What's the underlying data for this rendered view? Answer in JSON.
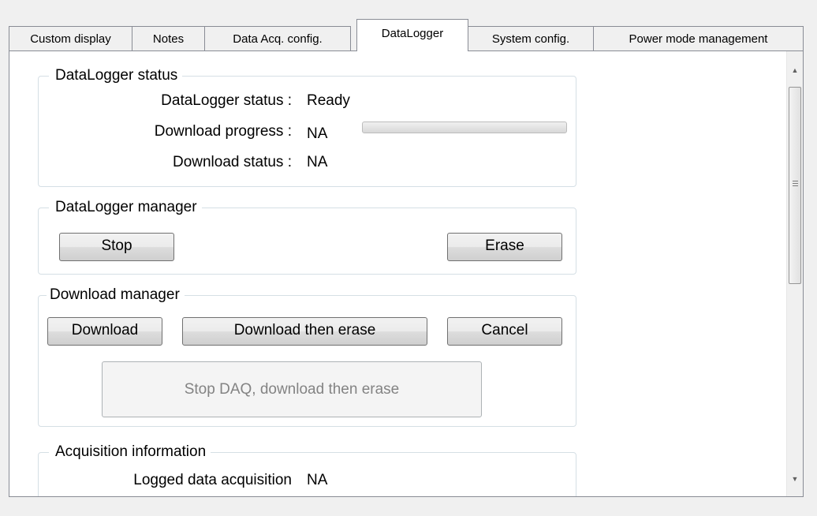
{
  "tabs": [
    {
      "label": "Custom display",
      "active": false
    },
    {
      "label": "Notes",
      "active": false
    },
    {
      "label": "Data Acq. config.",
      "active": false
    },
    {
      "label": "DataLogger",
      "active": true
    },
    {
      "label": "System config.",
      "active": false
    },
    {
      "label": "Power mode management",
      "active": false
    }
  ],
  "status_group": {
    "title": "DataLogger status",
    "status_label": "DataLogger status :",
    "status_value": "Ready",
    "progress_label": "Download progress :",
    "progress_value": "NA",
    "progress_fraction": 0,
    "dl_status_label": "Download status :",
    "dl_status_value": "NA"
  },
  "manager_group": {
    "title": "DataLogger manager",
    "stop_label": "Stop",
    "erase_label": "Erase"
  },
  "download_group": {
    "title": "Download manager",
    "download_label": "Download",
    "download_erase_label": "Download then erase",
    "cancel_label": "Cancel",
    "stop_daq_label": "Stop DAQ, download then erase"
  },
  "acq_group": {
    "title": "Acquisition information",
    "logged_label": "Logged data acquisition",
    "logged_value": "NA"
  },
  "scrollbar": {
    "up_icon": "arrow-up-icon",
    "down_icon": "arrow-down-icon"
  }
}
